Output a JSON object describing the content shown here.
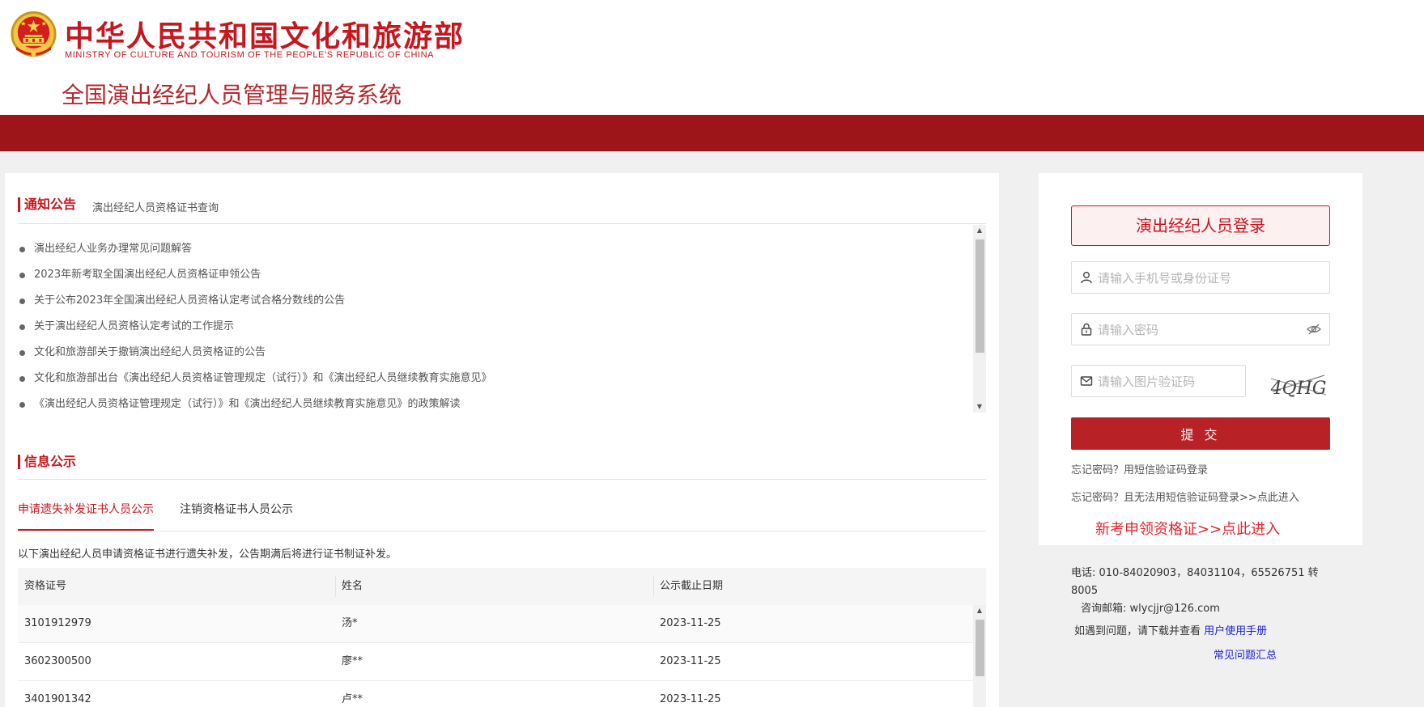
{
  "header": {
    "org_name_cn": "中华人民共和国文化和旅游部",
    "org_name_en": "MINISTRY OF CULTURE AND TOURISM OF THE PEOPLE'S REPUBLIC OF CHINA",
    "system_title": "全国演出经纪人员管理与服务系统",
    "brand_color": "#c8161d",
    "bar_color": "#9d1419"
  },
  "notice": {
    "title": "通知公告",
    "query_link": "演出经纪人员资格证书查询",
    "items": [
      "演出经纪人业务办理常见问题解答",
      "2023年新考取全国演出经纪人员资格证申领公告",
      "关于公布2023年全国演出经纪人员资格认定考试合格分数线的公告",
      "关于演出经纪人员资格认定考试的工作提示",
      "文化和旅游部关于撤销演出经纪人员资格证的公告",
      "文化和旅游部出台《演出经纪人员资格证管理规定（试行）》和《演出经纪人员继续教育实施意见》",
      "《演出经纪人员资格证管理规定（试行）》和《演出经纪人员继续教育实施意见》的政策解读"
    ]
  },
  "info": {
    "title": "信息公示",
    "tabs": [
      "申请遗失补发证书人员公示",
      "注销资格证书人员公示"
    ],
    "description": "以下演出经纪人员申请资格证书进行遗失补发，公告期满后将进行证书制证补发。",
    "columns": [
      "资格证号",
      "姓名",
      "公示截止日期"
    ],
    "rows": [
      [
        "3101912979",
        "汤*",
        "2023-11-25"
      ],
      [
        "3602300500",
        "廖**",
        "2023-11-25"
      ],
      [
        "3401901342",
        "卢**",
        "2023-11-25"
      ]
    ]
  },
  "login": {
    "title": "演出经纪人员登录",
    "account_placeholder": "请输入手机号或身份证号",
    "password_placeholder": "请输入密码",
    "captcha_placeholder": "请输入图片验证码",
    "captcha_text": "4QHG",
    "submit_label": "提 交",
    "forgot_sms": "忘记密码？用短信验证码登录",
    "forgot_no_sms": "忘记密码？且无法用短信验证码登录>>点此进入",
    "new_cert_link": "新考申领资格证>>点此进入"
  },
  "contact": {
    "phone": "电话: 010-84020903，84031104，65526751 转 8005",
    "email": "咨询邮箱: wlycjjr@126.com",
    "manual_prefix": "如遇到问题，请下载并查看",
    "manual_link": "用户使用手册",
    "faq_link": "常见问题汇总"
  }
}
